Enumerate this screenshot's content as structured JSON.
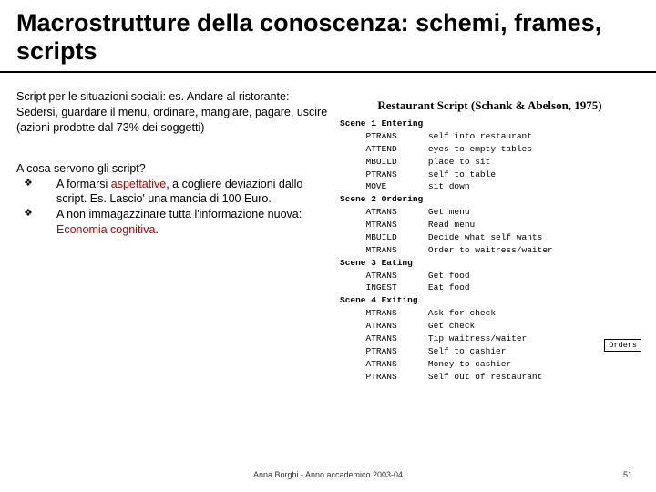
{
  "title": "Macrostrutture della conoscenza: schemi, frames, scripts",
  "left": {
    "p1a": "Script per le situazioni sociali: es. Andare al ristorante:",
    "p1b": "Sedersi, guardare il menu, ordinare, mangiare, pagare, uscire (azioni prodotte dal 73% dei soggetti)",
    "q": "A cosa servono gli script?",
    "b1_pre": "A formarsi ",
    "b1_hl": "aspettative",
    "b1_post": ", a cogliere deviazioni dallo script. Es. Lascio' una mancia di 100 Euro.",
    "b2_pre": "A non immagazzinare tutta l'informazione nuova: ",
    "b2_hl": "Economia cognitiva",
    "b2_post": "."
  },
  "script": {
    "title": "Restaurant Script (Schank & Abelson, 1975)",
    "s1": "Scene 1 Entering",
    "s1l1": "     PTRANS      self into restaurant",
    "s1l2": "     ATTEND      eyes to empty tables",
    "s1l3": "     MBUILD      place to sit",
    "s1l4": "     PTRANS      self to table",
    "s1l5": "     MOVE        sit down",
    "s2": "Scene 2 Ordering",
    "s2l1": "     ATRANS      Get menu",
    "s2l2": "     MTRANS      Read menu",
    "s2l3": "     MBUILD      Decide what self wants",
    "s2l4": "     MTRANS      Order to waitress/waiter",
    "s3": "Scene 3 Eating",
    "s3l1": "     ATRANS      Get food",
    "s3l2": "     INGEST      Eat food",
    "s4": "Scene 4 Exiting",
    "s4l1": "     MTRANS      Ask for check",
    "s4l2": "     ATRANS      Get check",
    "s4l3": "     ATRANS      Tip waitress/waiter",
    "s4l4": "     PTRANS      Self to cashier",
    "s4l5": "     ATRANS      Money to cashier",
    "s4l6": "     PTRANS      Self out of restaurant"
  },
  "orders": "Orders",
  "footer": {
    "center": "Anna Borghi - Anno accademico 2003-04",
    "page": "51"
  }
}
